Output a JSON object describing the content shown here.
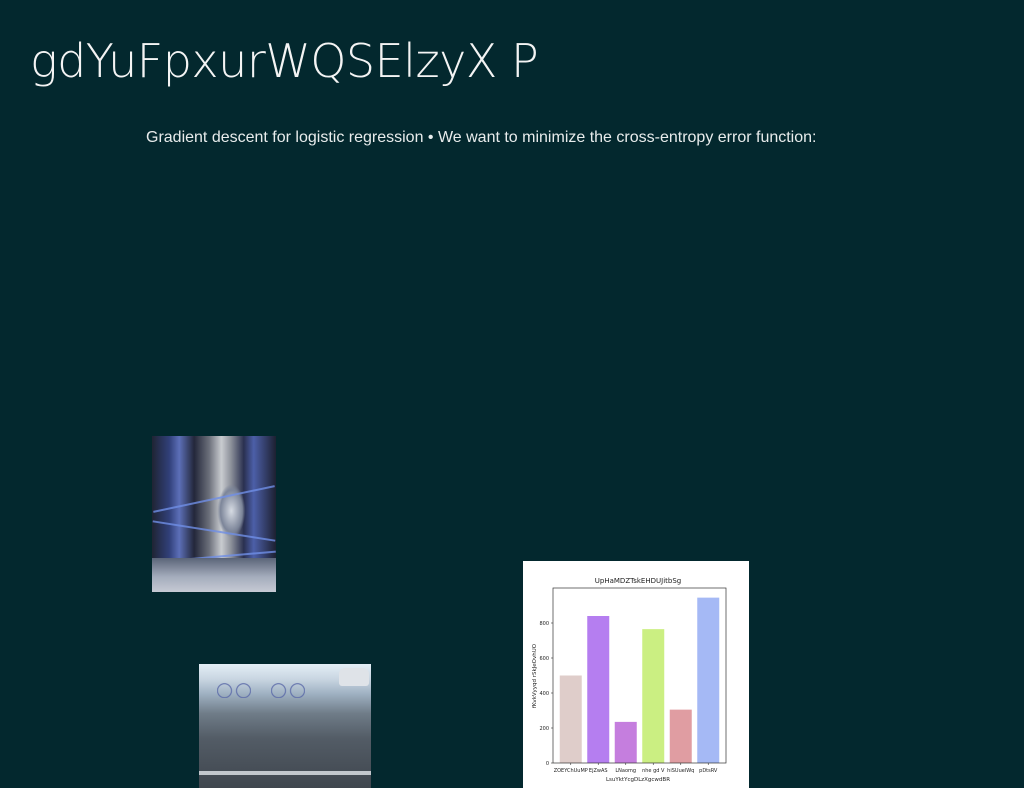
{
  "slide": {
    "title": "gdYuFpxurWQSElzyX P",
    "subtitle": "Gradient descent for logistic regression • We want to minimize the cross-entropy error function:"
  },
  "images": [
    {
      "name": "photo-disco-ball"
    },
    {
      "name": "photo-street-motorbikes"
    }
  ],
  "chart_data": {
    "type": "bar",
    "title": "UpHaMDZTskEHDUJitbSg",
    "xlabel": "LsuYktYcgDLzXgcwdBR",
    "ylabel": "fKvkVyyqd rSkJeOvhUO",
    "categories": [
      "ZOEYChUuMP",
      "EjZwAS",
      "LNaomg",
      "nhe gd V",
      "hiSUuelWq",
      "pDtsRV"
    ],
    "values": [
      500,
      840,
      235,
      765,
      305,
      945
    ],
    "colors": [
      "#dfcdca",
      "#b57ef0",
      "#c57ede",
      "#cbef82",
      "#e09da2",
      "#a5b9f5"
    ],
    "ylim": [
      0,
      1000
    ],
    "yticks": [
      0,
      200,
      400,
      600,
      800
    ],
    "grid": false,
    "legend": "none"
  }
}
